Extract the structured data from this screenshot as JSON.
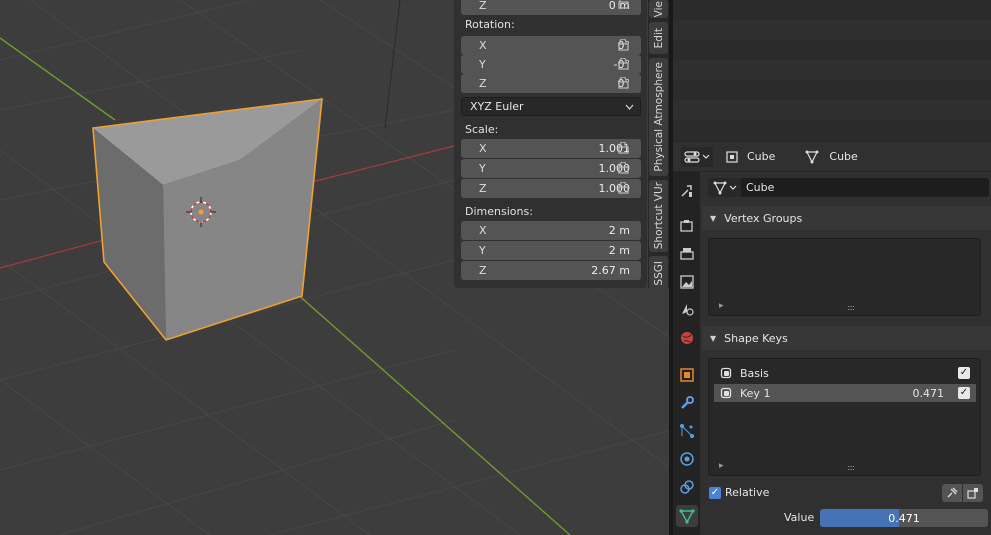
{
  "npanel": {
    "location_z_axis": "Z",
    "location_z_value": "0 m",
    "rotation_label": "Rotation:",
    "rotation": [
      {
        "axis": "X",
        "value": "0°"
      },
      {
        "axis": "Y",
        "value": "-0°"
      },
      {
        "axis": "Z",
        "value": "0°"
      }
    ],
    "rotation_mode": "XYZ Euler",
    "scale_label": "Scale:",
    "scale": [
      {
        "axis": "X",
        "value": "1.001"
      },
      {
        "axis": "Y",
        "value": "1.000"
      },
      {
        "axis": "Z",
        "value": "1.000"
      }
    ],
    "dimensions_label": "Dimensions:",
    "dimensions": [
      {
        "axis": "X",
        "value": "2 m"
      },
      {
        "axis": "Y",
        "value": "2 m"
      },
      {
        "axis": "Z",
        "value": "2.67 m"
      }
    ]
  },
  "vertical_tabs": [
    "Vie",
    "Edit",
    "Physical Atmosphere",
    "Shortcut VUr",
    "SSGI"
  ],
  "properties": {
    "breadcrumb_object": "Cube",
    "breadcrumb_mesh": "Cube",
    "mesh_name": "Cube",
    "vertex_groups_title": "Vertex Groups",
    "shape_keys_title": "Shape Keys",
    "shape_keys": [
      {
        "name": "Basis",
        "value": ""
      },
      {
        "name": "Key 1",
        "value": "0.471"
      }
    ],
    "relative_label": "Relative",
    "value_label": "Value",
    "value_display": "0.471",
    "value_fraction": 0.471
  },
  "colors": {
    "accent": "#4772b3",
    "selection_outline": "#f0a030",
    "x_axis": "#a83a3a",
    "y_axis": "#6e9c2c"
  },
  "icons": {
    "resize_grip": "::::",
    "tri_left": "▸"
  }
}
